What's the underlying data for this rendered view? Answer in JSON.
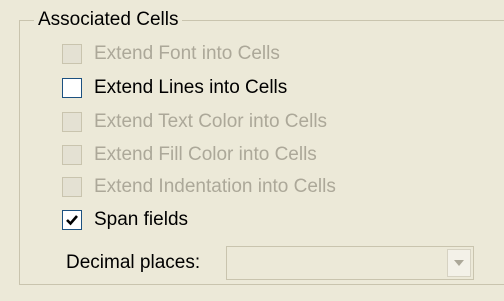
{
  "group": {
    "title": "Associated Cells"
  },
  "options": [
    {
      "label": "Extend Font into Cells",
      "checked": false,
      "enabled": false
    },
    {
      "label": "Extend Lines into Cells",
      "checked": false,
      "enabled": true
    },
    {
      "label": "Extend Text Color into Cells",
      "checked": false,
      "enabled": false
    },
    {
      "label": "Extend Fill Color into Cells",
      "checked": false,
      "enabled": false
    },
    {
      "label": "Extend Indentation into Cells",
      "checked": false,
      "enabled": false
    },
    {
      "label": "Span fields",
      "checked": true,
      "enabled": true
    }
  ],
  "decimal": {
    "label": "Decimal places:",
    "value": "",
    "enabled": false
  },
  "colors": {
    "background": "#ECE9D8",
    "disabled_text": "#ACA899",
    "checkbox_border": "#1C5180"
  },
  "icons": {
    "checkmark": "checkmark-icon",
    "dropdown": "chevron-down-icon"
  }
}
